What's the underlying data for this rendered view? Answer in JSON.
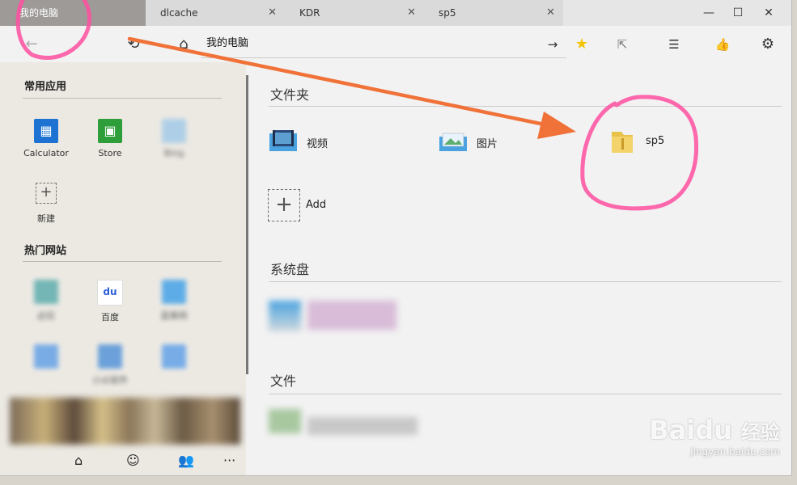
{
  "tabs": [
    {
      "label": "我的电脑",
      "close": ""
    },
    {
      "label": "dlcache",
      "close": "✕"
    },
    {
      "label": "KDR",
      "close": "✕"
    },
    {
      "label": "sp5",
      "close": "✕"
    }
  ],
  "window_controls": {
    "minimize": "—",
    "maximize": "☐",
    "close": "✕"
  },
  "toolbar": {
    "back_icon": "←",
    "history_icon": "⟲",
    "home_icon": "⌂",
    "address": "我的电脑",
    "go_icon": "→",
    "star_icon": "★",
    "share_icon": "⇱",
    "list_icon": "☰",
    "like_icon": "👍",
    "settings_icon": "⚙"
  },
  "left": {
    "common_apps_title": "常用应用",
    "apps": [
      {
        "label": "Calculator",
        "color": "#1e73d2",
        "glyph": "▦"
      },
      {
        "label": "Store",
        "color": "#2e9e3a",
        "glyph": "▣"
      },
      {
        "label": "Bing",
        "color": "#9fc8e8",
        "glyph": ""
      }
    ],
    "new_label": "新建",
    "new_icon": "+",
    "hot_sites_title": "热门网站",
    "sites": [
      {
        "label": "必应",
        "color": "#5aa"
      },
      {
        "label": "百度",
        "color": "#2c5fd8"
      },
      {
        "label": "蓝奏网",
        "color": "#3a9ee8"
      },
      {
        "label": "",
        "color": "#5d9ee6"
      },
      {
        "label": "小众软件",
        "color": "#4b8fd8"
      },
      {
        "label": "",
        "color": "#5a9ee8"
      }
    ],
    "baidu_glyph": "du",
    "bottom_nav": {
      "home": "⌂",
      "robot": "☺",
      "people": "👥",
      "more": "···"
    }
  },
  "right": {
    "folders_title": "文件夹",
    "folders": [
      {
        "label": "视频"
      },
      {
        "label": "图片"
      },
      {
        "label": "sp5"
      }
    ],
    "add_label": "Add",
    "add_icon": "+",
    "system_disk_title": "系统盘",
    "files_title": "文件"
  },
  "watermark": {
    "text": "Bai",
    "text2": "du",
    "text3": "经验",
    "url": "jingyan.baidu.com"
  },
  "colors": {
    "annotation_pink": "#ff4fa0",
    "arrow_orange": "#f07238",
    "active_tab": "#9e9a98",
    "folder_yellow": "#e9c24a",
    "star": "#f5c400"
  }
}
